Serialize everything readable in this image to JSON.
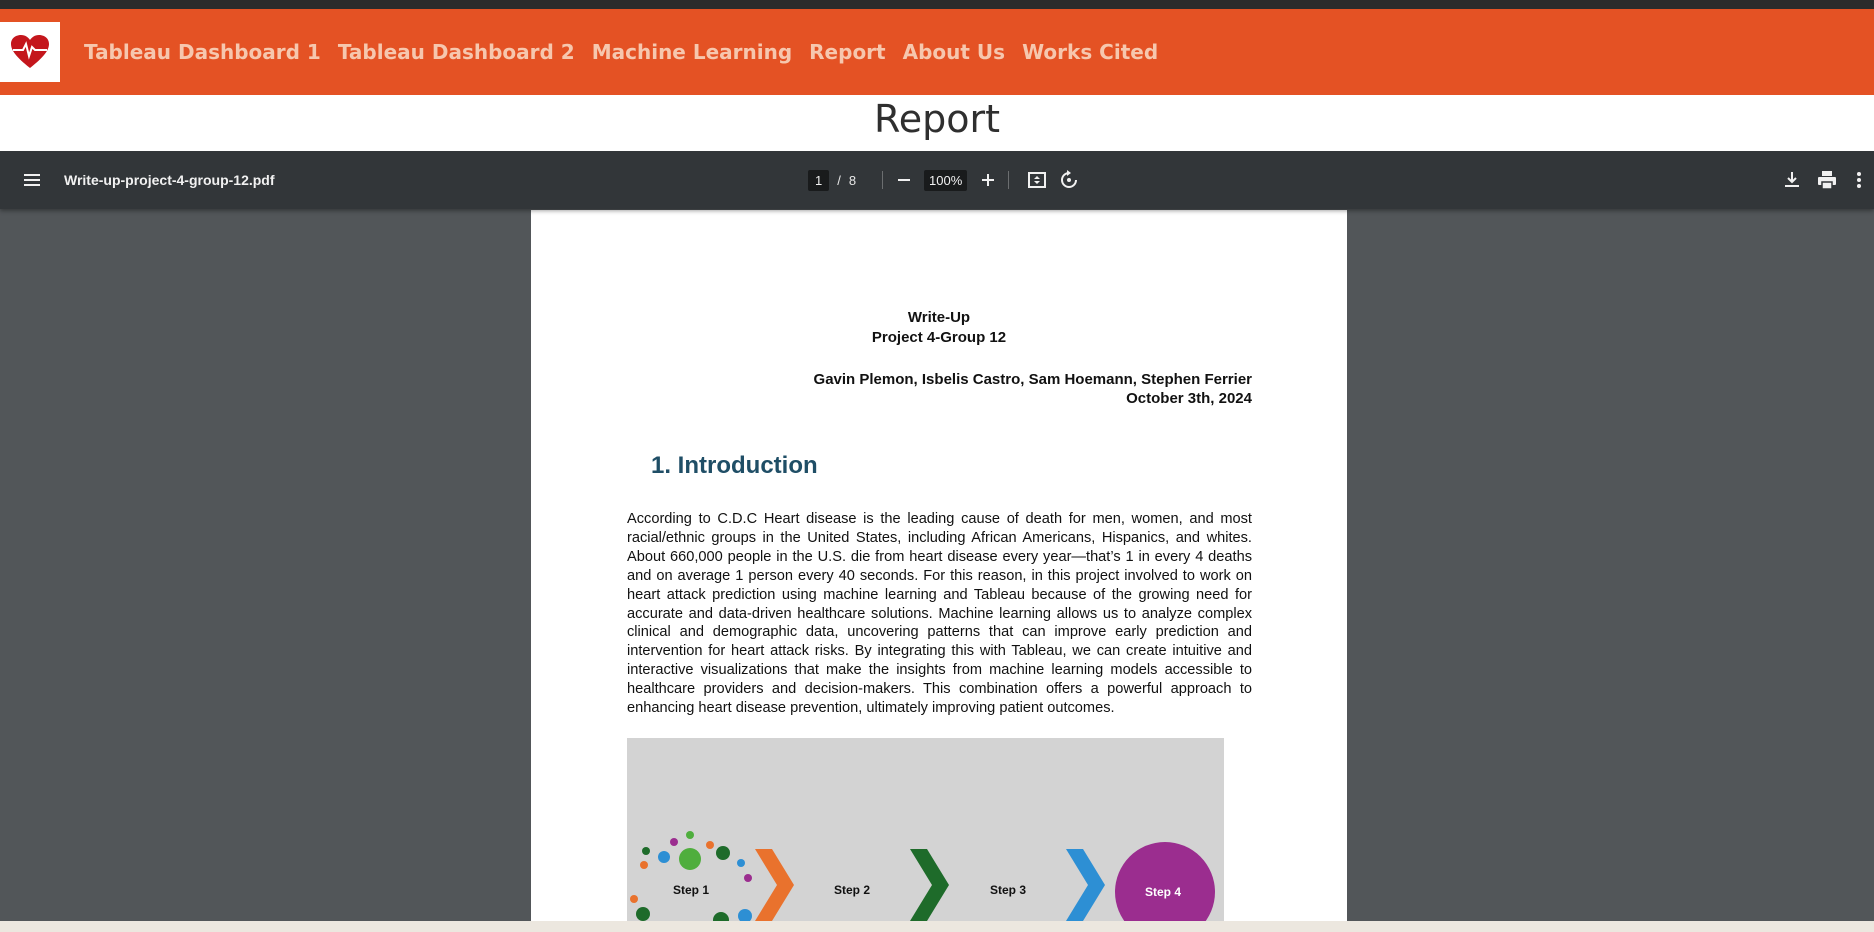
{
  "nav": {
    "links": [
      "Tableau Dashboard 1",
      "Tableau Dashboard 2",
      "Machine Learning",
      "Report",
      "About Us",
      "Works Cited"
    ],
    "logo_icon": "heart-pulse-icon"
  },
  "page_title": "Report",
  "viewer": {
    "filename": "Write-up-project-4-group-12.pdf",
    "current_page": "1",
    "page_separator": "/",
    "total_pages": "8",
    "zoom": "100%",
    "icons": [
      "menu-icon",
      "zoom-out-icon",
      "zoom-in-icon",
      "fit-page-icon",
      "rotate-icon",
      "download-icon",
      "print-icon",
      "more-icon"
    ]
  },
  "document": {
    "title": "Write-Up",
    "subtitle": "Project 4-Group 12",
    "authors": "Gavin Plemon, Isbelis Castro, Sam Hoemann, Stephen Ferrier",
    "date": "October 3th, 2024",
    "section_heading": "1. Introduction",
    "paragraph": "According to C.D.C Heart disease is the leading cause of death for men, women, and most racial/ethnic groups in the United States, including African Americans, Hispanics, and whites. About 660,000 people in the U.S. die from heart disease every year—that’s 1 in every 4 deaths and on average 1 person every 40 seconds. For this reason, in this project involved to work on heart attack prediction using machine learning and Tableau because of the growing need for accurate and data-driven healthcare solutions. Machine learning allows us to analyze complex clinical and demographic data, uncovering patterns that can improve early prediction and intervention for heart attack risks. By integrating this with Tableau, we can create intuitive and interactive visualizations that make the insights from machine learning models accessible to healthcare providers and decision-makers. This combination offers a powerful approach to enhancing heart disease prevention, ultimately improving patient outcomes.",
    "figure_steps": [
      "Step 1",
      "Step 2",
      "Step 3",
      "Step 4"
    ]
  },
  "colors": {
    "navbar": "#e45224",
    "nav_link": "#f6c7ae",
    "toolbar": "#323639",
    "viewer_bg": "#525659",
    "heading": "#1f4e66",
    "step4_circle": "#9b2d8f"
  }
}
